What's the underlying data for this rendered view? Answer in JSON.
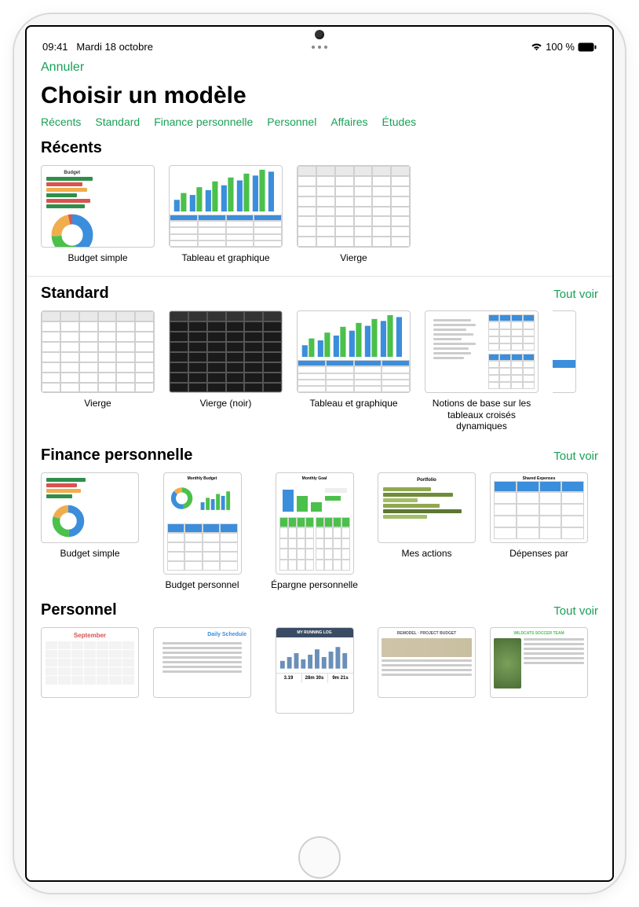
{
  "status": {
    "time": "09:41",
    "date": "Mardi 18 octobre",
    "battery_pct": "100 %"
  },
  "accent_color": "#18a058",
  "actions": {
    "cancel": "Annuler",
    "see_all": "Tout voir"
  },
  "page_title": "Choisir un modèle",
  "tabs": [
    "Récents",
    "Standard",
    "Finance personnelle",
    "Personnel",
    "Affaires",
    "Études"
  ],
  "sections": {
    "recents": {
      "title": "Récents",
      "items": [
        {
          "label": "Budget simple"
        },
        {
          "label": "Tableau et graphique"
        },
        {
          "label": "Vierge"
        }
      ]
    },
    "standard": {
      "title": "Standard",
      "items": [
        {
          "label": "Vierge"
        },
        {
          "label": "Vierge (noir)"
        },
        {
          "label": "Tableau et graphique"
        },
        {
          "label": "Notions de base sur les tableaux croisés dynamiques"
        }
      ]
    },
    "finance": {
      "title": "Finance personnelle",
      "items": [
        {
          "label": "Budget simple"
        },
        {
          "label": "Budget personnel"
        },
        {
          "label": "Épargne personnelle"
        },
        {
          "label": "Mes actions"
        },
        {
          "label": "Dépenses par"
        }
      ]
    },
    "personal": {
      "title": "Personnel",
      "items": [
        {
          "label": ""
        },
        {
          "label": ""
        },
        {
          "label": ""
        },
        {
          "label": ""
        },
        {
          "label": ""
        }
      ],
      "thumb_titles": [
        "September",
        "Daily Schedule",
        "MY RUNNING LOG",
        "REMODEL · PROJECT BUDGET",
        "WILDCATS SOCCER TEAM"
      ]
    }
  }
}
